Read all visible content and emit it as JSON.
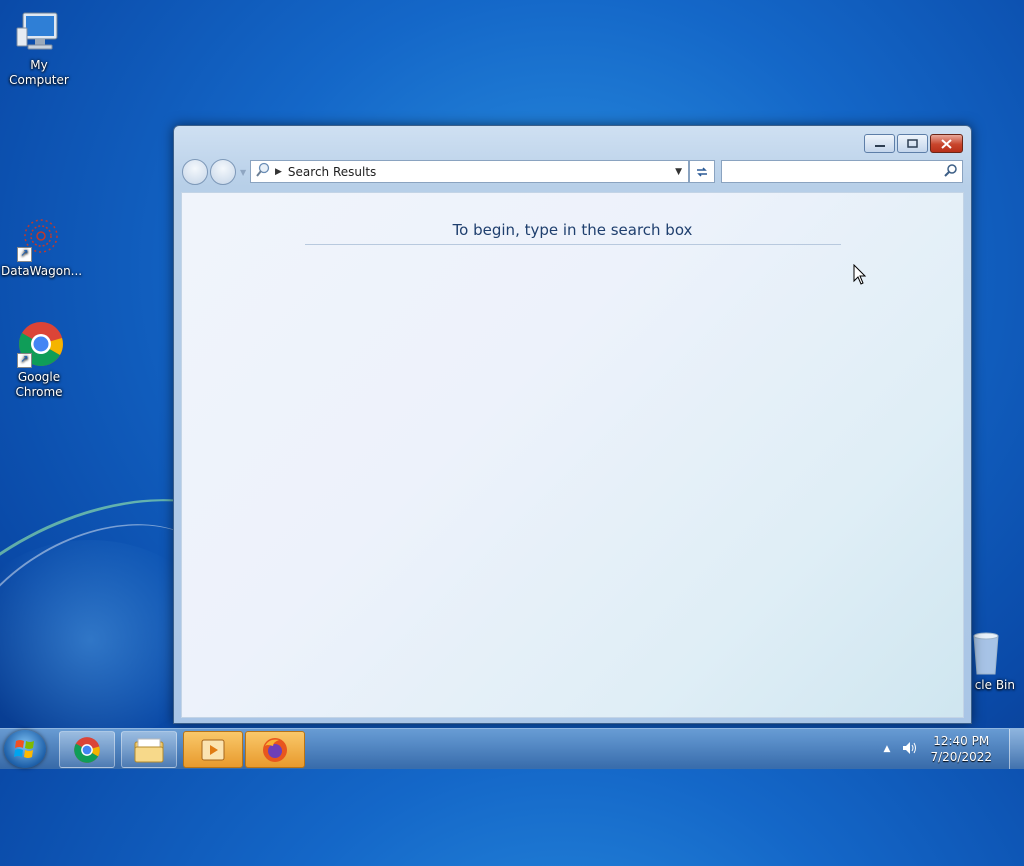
{
  "desktop": {
    "icons": [
      {
        "label": "My Computer",
        "icon": "computer-icon"
      },
      {
        "label": "DataWagon...",
        "icon": "datawagon-icon"
      },
      {
        "label": "Google Chrome",
        "icon": "chrome-icon"
      },
      {
        "label": "cle Bin",
        "icon": "recycle-bin-icon"
      }
    ]
  },
  "window": {
    "address": "Search Results",
    "search_value": "",
    "hint": "To begin, type in the search box"
  },
  "taskbar": {
    "items": [
      "chrome-icon",
      "explorer-folder-icon",
      "media-player-icon",
      "firefox-icon"
    ],
    "time": "12:40 PM",
    "date": "7/20/2022"
  },
  "colors": {
    "desktop": "#1467c8",
    "close_button": "#c8452c",
    "hint_text": "#1f3f6e"
  }
}
